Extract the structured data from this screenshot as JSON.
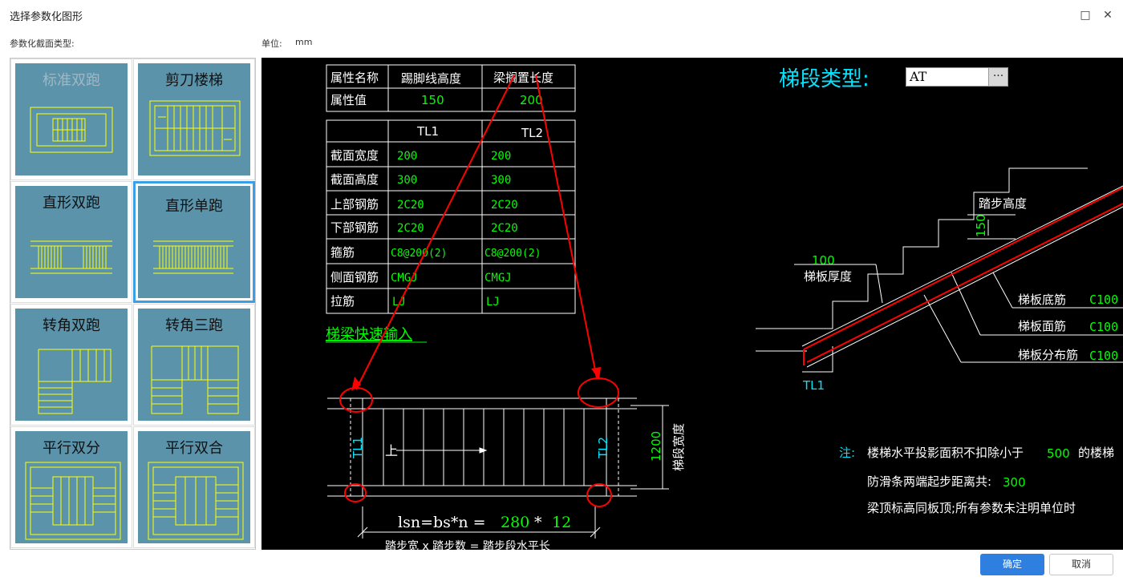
{
  "window": {
    "title": "选择参数化图形",
    "restore_icon": "□",
    "close_icon": "✕"
  },
  "labels": {
    "section_type": "参数化截面类型:",
    "unit_label": "单位:",
    "unit_value": "mm"
  },
  "gallery": [
    {
      "name": "标准双跑",
      "selected": false,
      "dim": true
    },
    {
      "name": "剪刀楼梯",
      "selected": false,
      "dim": false
    },
    {
      "name": "直形双跑",
      "selected": false,
      "dim": false
    },
    {
      "name": "直形单跑",
      "selected": true,
      "dim": false
    },
    {
      "name": "转角双跑",
      "selected": false,
      "dim": false
    },
    {
      "name": "转角三跑",
      "selected": false,
      "dim": false
    },
    {
      "name": "平行双分",
      "selected": false,
      "dim": false
    },
    {
      "name": "平行双合",
      "selected": false,
      "dim": false
    }
  ],
  "prop_table": {
    "header": [
      "属性名称",
      "踢脚线高度",
      "梁搁置长度"
    ],
    "values": [
      "属性值",
      "150",
      "200"
    ]
  },
  "beam_table": {
    "cols": [
      "TL1",
      "TL2"
    ],
    "rows": [
      {
        "label": "截面宽度",
        "tl1": "200",
        "tl2": "200"
      },
      {
        "label": "截面高度",
        "tl1": "300",
        "tl2": "300"
      },
      {
        "label": "上部钢筋",
        "tl1": "2C20",
        "tl2": "2C20"
      },
      {
        "label": "下部钢筋",
        "tl1": "2C20",
        "tl2": "2C20"
      },
      {
        "label": "箍筋",
        "tl1": "C8@200(2)",
        "tl2": "C8@200(2)"
      },
      {
        "label": "侧面钢筋",
        "tl1": "CMGJ",
        "tl2": "CMGJ"
      },
      {
        "label": "拉筋",
        "tl1": "LJ",
        "tl2": "LJ"
      }
    ]
  },
  "quick_input": "梯梁快速输入",
  "type": {
    "label": "梯段类型:",
    "value": "AT",
    "button": "···"
  },
  "section": {
    "step_height_label": "踏步高度",
    "step_height_value": "150",
    "slab_thickness_value": "100",
    "slab_thickness_label": "梯板厚度",
    "bottom_bar_label": "梯板底筋",
    "bottom_bar_value": "C100",
    "top_bar_label": "梯板面筋",
    "top_bar_value": "C100",
    "dist_bar_label": "梯板分布筋",
    "dist_bar_value": "C100",
    "tl1": "TL1"
  },
  "plan": {
    "tl1": "TL1",
    "tl2": "TL2",
    "up": "上",
    "width_value": "1200",
    "width_label": "梯段宽度",
    "formula_prefix": "lsn=bs*n =",
    "bs": "280",
    "star": "*",
    "n": "12",
    "formula_caption": "踏步宽 x 踏步数 = 踏步段水平长"
  },
  "notes": {
    "prefix": "注:",
    "line1_a": "楼梯水平投影面积不扣除小于",
    "line1_val": "500",
    "line1_b": "的楼梯",
    "line2_a": "防滑条两端起步距离共:",
    "line2_val": "300",
    "line3": "梁顶标高同板顶;所有参数未注明单位时"
  },
  "buttons": {
    "ok": "确定",
    "cancel": "取消"
  },
  "colors": {
    "canvas_bg": "#000000",
    "cad_white": "#ffffff",
    "cad_green": "#00ff00",
    "cad_cyan": "#00e5ff",
    "cad_red": "#ff0000",
    "tile_bg": "#5b93ab",
    "tile_lines": "#ffff00",
    "ok_button": "#2f7fe0"
  }
}
